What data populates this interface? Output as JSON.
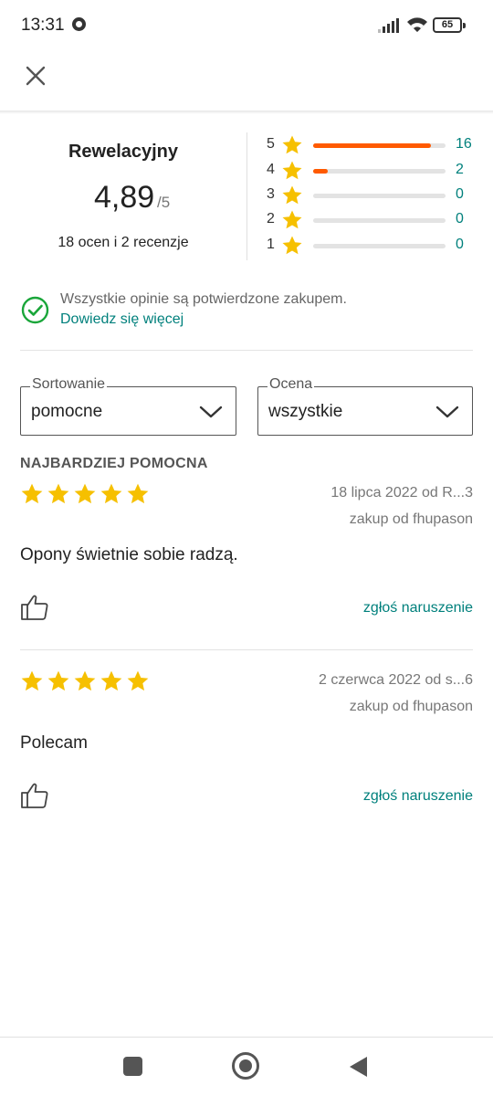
{
  "status_bar": {
    "time": "13:31",
    "battery": "65"
  },
  "icons": {
    "close": "close-icon",
    "star": "star-icon",
    "verified": "check-circle-icon",
    "chevron": "chevron-down-icon",
    "thumb": "thumbs-up-icon"
  },
  "colors": {
    "accent_orange": "#ff5a00",
    "star_yellow": "#f6c000",
    "link_teal": "#00807c",
    "verified_green": "#1aa63a"
  },
  "summary": {
    "title": "Rewelacyjny",
    "score": "4,89",
    "max": "/5",
    "count": "18 ocen i 2 recenzje"
  },
  "distribution": [
    {
      "stars": "5",
      "count": "16",
      "fraction": 0.89
    },
    {
      "stars": "4",
      "count": "2",
      "fraction": 0.11
    },
    {
      "stars": "3",
      "count": "0",
      "fraction": 0
    },
    {
      "stars": "2",
      "count": "0",
      "fraction": 0
    },
    {
      "stars": "1",
      "count": "0",
      "fraction": 0
    }
  ],
  "verified": {
    "text": "Wszystkie opinie są potwierdzone zakupem.",
    "link": "Dowiedz się więcej"
  },
  "filters": {
    "sort_label": "Sortowanie",
    "sort_value": "pomocne",
    "rating_label": "Ocena",
    "rating_value": "wszystkie"
  },
  "section_heading": "NAJBARDZIEJ POMOCNA",
  "reviews": [
    {
      "rating": 5,
      "date": "18 lipca 2022 od R...3",
      "seller": "zakup od fhupason",
      "text": "Opony świetnie sobie radzą.",
      "report": "zgłoś naruszenie"
    },
    {
      "rating": 5,
      "date": "2 czerwca 2022 od s...6",
      "seller": "zakup od fhupason",
      "text": "Polecam",
      "report": "zgłoś naruszenie"
    }
  ]
}
